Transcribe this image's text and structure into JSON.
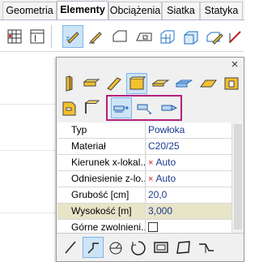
{
  "ribbon_tabs": [
    {
      "label": "Geometria",
      "active": false
    },
    {
      "label": "Elementy",
      "active": true
    },
    {
      "label": "Obciążenia",
      "active": false
    },
    {
      "label": "Siatka",
      "active": false
    },
    {
      "label": "Statyka",
      "active": false
    }
  ],
  "ribbon_icons": [
    "stacked-grid-icon",
    "grid-text-icon",
    "pencil-drag-icon",
    "pencil-icon",
    "surface-outline-icon",
    "opening-icon",
    "3d-grid-icon",
    "layered-surface-icon",
    "pencil-surface-icon",
    "diagonal-line-icon"
  ],
  "panel": {
    "close_label": "×",
    "properties": [
      {
        "label": "Typ",
        "value": "Powłoka",
        "auto_marker": false
      },
      {
        "label": "Materiał",
        "value": "C20/25",
        "auto_marker": false
      },
      {
        "label": "Kierunek x-lokal...",
        "value": "Auto",
        "auto_marker": true
      },
      {
        "label": "Odniesienie z-lo...",
        "value": "Auto",
        "auto_marker": true
      },
      {
        "label": "Grubość [cm]",
        "value": "20,0",
        "auto_marker": false
      },
      {
        "label": "Wysokość [m]",
        "value": "3,000",
        "auto_marker": false
      },
      {
        "label": "Górne zwolnieni...",
        "value": "",
        "auto_marker": false
      }
    ],
    "expander_label": "+",
    "auto_marker_symbol": "×"
  },
  "colors": {
    "highlight_border": "#b5207c",
    "selected_row": "#e8e4c8",
    "value_text": "#1a3b8c",
    "auto_marker": "#d01818"
  }
}
